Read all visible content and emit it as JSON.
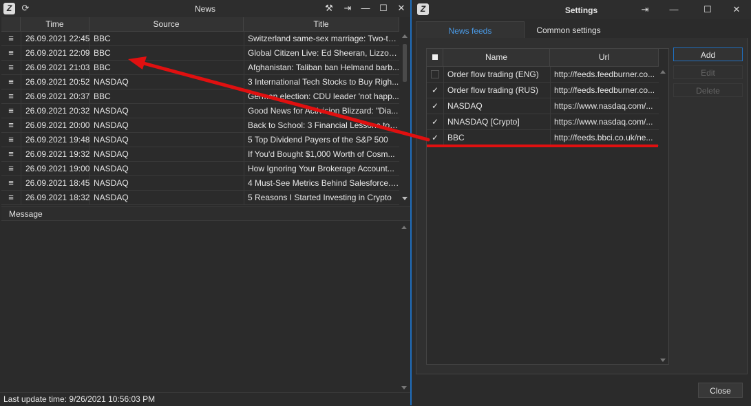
{
  "news": {
    "title": "News",
    "columns": {
      "time": "Time",
      "source": "Source",
      "title": "Title"
    },
    "rows": [
      {
        "time": "26.09.2021 22:45",
        "source": "BBC",
        "title": "Switzerland same-sex marriage: Two-th..."
      },
      {
        "time": "26.09.2021 22:09",
        "source": "BBC",
        "title": "Global Citizen Live: Ed Sheeran, Lizzo a..."
      },
      {
        "time": "26.09.2021 21:03",
        "source": "BBC",
        "title": "Afghanistan: Taliban ban Helmand barb..."
      },
      {
        "time": "26.09.2021 20:52",
        "source": "NASDAQ",
        "title": "3 International Tech Stocks to Buy Righ..."
      },
      {
        "time": "26.09.2021 20:37",
        "source": "BBC",
        "title": "German election: CDU leader 'not happ..."
      },
      {
        "time": "26.09.2021 20:32",
        "source": "NASDAQ",
        "title": "Good News for Activision Blizzard: \"Dia..."
      },
      {
        "time": "26.09.2021 20:00",
        "source": "NASDAQ",
        "title": "Back to School: 3 Financial Lessons to T..."
      },
      {
        "time": "26.09.2021 19:48",
        "source": "NASDAQ",
        "title": "5 Top Dividend Payers of the S&P 500"
      },
      {
        "time": "26.09.2021 19:32",
        "source": "NASDAQ",
        "title": "If You'd Bought $1,000 Worth of Cosm..."
      },
      {
        "time": "26.09.2021 19:00",
        "source": "NASDAQ",
        "title": "How Ignoring Your Brokerage Account..."
      },
      {
        "time": "26.09.2021 18:45",
        "source": "NASDAQ",
        "title": "4 Must-See Metrics Behind Salesforce.c..."
      },
      {
        "time": "26.09.2021 18:32",
        "source": "NASDAQ",
        "title": "5 Reasons I Started Investing in Crypto"
      }
    ],
    "message_label": "Message",
    "status": "Last update time: 9/26/2021 10:56:03 PM"
  },
  "settings": {
    "title": "Settings",
    "tabs": {
      "active": "News feeds",
      "other": "Common settings"
    },
    "columns": {
      "name": "Name",
      "url": "Url"
    },
    "feeds": [
      {
        "name": "Order flow trading (ENG)",
        "url": "http://feeds.feedburner.co...",
        "checked": false
      },
      {
        "name": "Order flow trading (RUS)",
        "url": "http://feeds.feedburner.co...",
        "checked": true
      },
      {
        "name": "NASDAQ",
        "url": "https://www.nasdaq.com/...",
        "checked": true
      },
      {
        "name": "NNASDAQ [Crypto]",
        "url": "https://www.nasdaq.com/...",
        "checked": true
      },
      {
        "name": "BBC",
        "url": "http://feeds.bbci.co.uk/ne...",
        "checked": true
      }
    ],
    "buttons": {
      "add": "Add",
      "edit": "Edit",
      "delete": "Delete",
      "close": "Close"
    }
  },
  "colors": {
    "accent": "#1f6fbf",
    "annotation": "#e01010",
    "active_tab": "#4a9be8"
  },
  "icons": {
    "logo": "app-logo-icon",
    "refresh": "refresh-icon",
    "tools": "tools-icon",
    "pin": "pin-icon",
    "minimize": "minimize-icon",
    "maximize": "maximize-icon",
    "close": "close-icon",
    "rss": "rss-icon",
    "check": "checkmark-icon"
  }
}
